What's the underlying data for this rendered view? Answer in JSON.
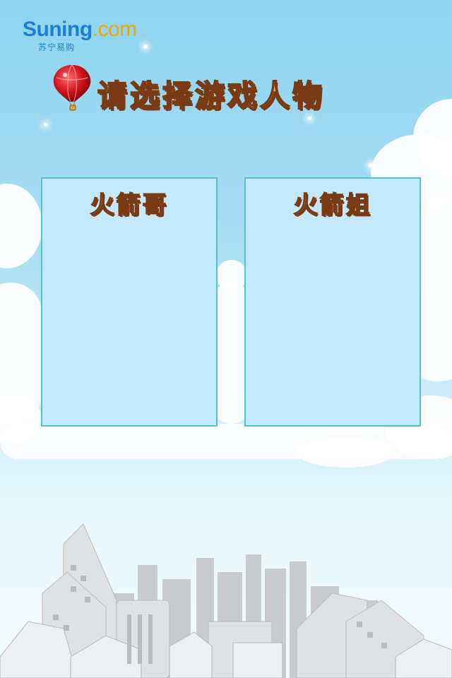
{
  "brand": {
    "name": "Suning",
    "suffix": ".com",
    "subtitle": "苏宁易购"
  },
  "title": "请选择游戏人物",
  "characters": [
    {
      "name": "火箭哥"
    },
    {
      "name": "火箭姐"
    }
  ],
  "colors": {
    "sky_top": "#8dd3ef",
    "card_fill": "#c3e9fb",
    "card_border": "#54c3c7",
    "title_text": "#f6a83a",
    "title_outline": "#7a3b14",
    "brand_blue": "#1d7fd1",
    "brand_orange": "#f2a400"
  }
}
